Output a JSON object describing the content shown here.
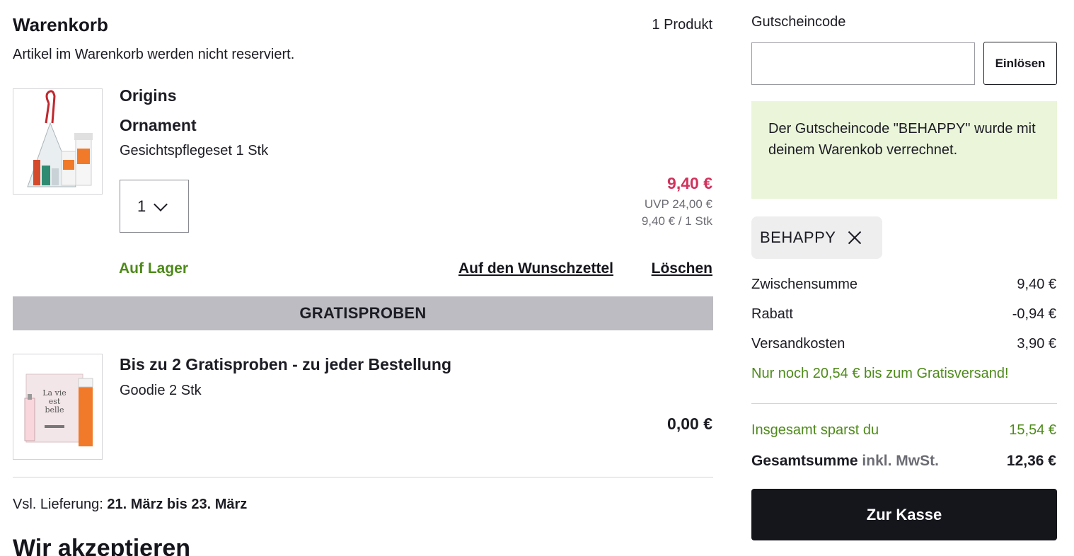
{
  "cart": {
    "title": "Warenkorb",
    "count": "1 Produkt",
    "note": "Artikel im Warenkorb werden nicht reserviert."
  },
  "item": {
    "brand": "Origins",
    "name": "Ornament",
    "description": "Gesichtspflegeset 1 Stk",
    "quantity": "1",
    "price": "9,40 €",
    "uvp": "UVP 24,00 €",
    "unit_price": "9,40 € / 1 Stk",
    "stock": "Auf Lager",
    "wishlist_label": "Auf den Wunschzettel",
    "delete_label": "Löschen",
    "icon": "gift-set-ornament-image"
  },
  "free_samples": {
    "header": "GRATISPROBEN",
    "title": "Bis zu 2 Gratisproben - zu jeder Bestellung",
    "description": "Goodie 2 Stk",
    "price": "0,00 €",
    "icon": "perfume-samples-image"
  },
  "delivery": {
    "label": "Vsl. Lieferung:",
    "dates": "21. März bis 23. März"
  },
  "accept_heading": "Wir akzeptieren",
  "coupon": {
    "label": "Gutscheincode",
    "value": "",
    "placeholder": "",
    "redeem_label": "Einlösen",
    "notice": "Der Gutscheincode \"BEHAPPY\" wurde mit deinem Warenkob verrechnet.",
    "applied_code": "BEHAPPY"
  },
  "summary": {
    "subtotal_label": "Zwischensumme",
    "subtotal_value": "9,40 €",
    "discount_label": "Rabatt",
    "discount_value": "-0,94 €",
    "shipping_label": "Versandkosten",
    "shipping_value": "3,90 €",
    "free_shipping_hint": "Nur noch 20,54 € bis zum Gratisversand!",
    "savings_label": "Insgesamt sparst du",
    "savings_value": "15,54 €",
    "total_label": "Gesamtsumme",
    "total_vat": "inkl. MwSt.",
    "total_value": "12,36 €",
    "checkout_label": "Zur Kasse"
  },
  "colors": {
    "sale_price": "#d1335e",
    "in_stock": "#4e8a1a",
    "notice_bg": "#eaf5da",
    "checkout_bg": "#15151c"
  }
}
